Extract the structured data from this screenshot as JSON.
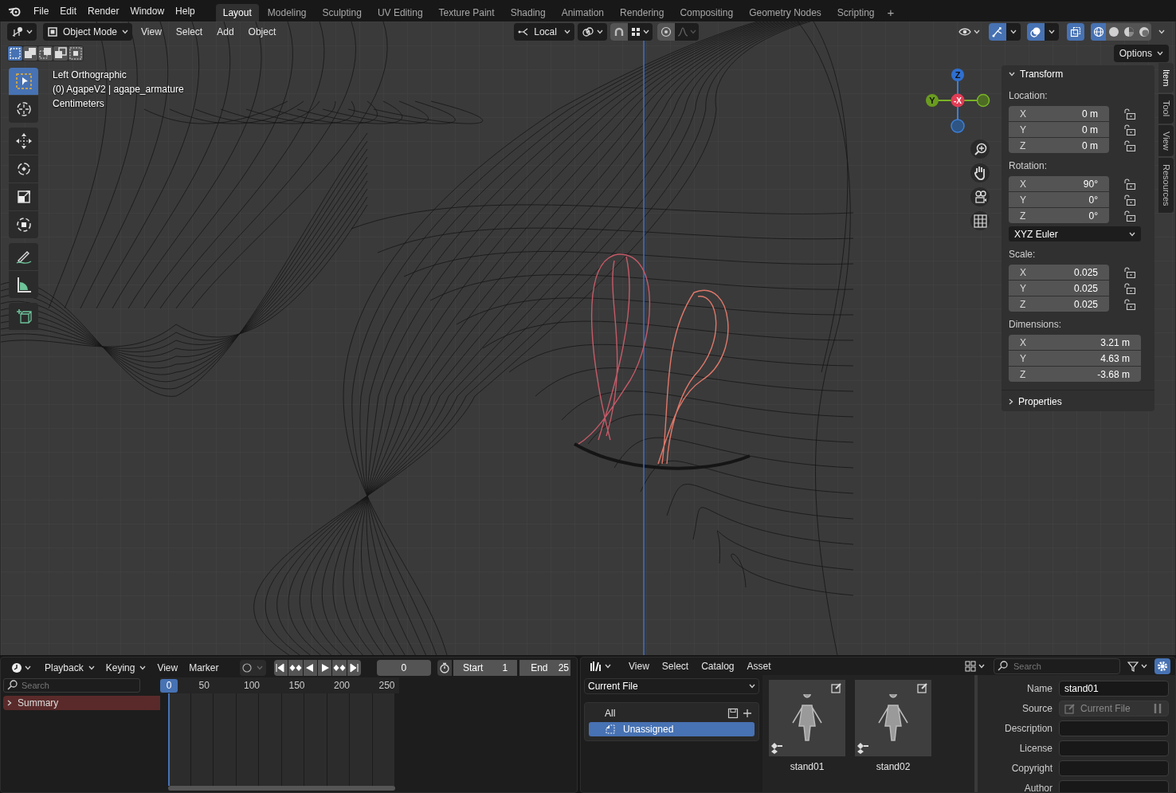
{
  "menu": [
    "File",
    "Edit",
    "Render",
    "Window",
    "Help"
  ],
  "workspaces": [
    {
      "label": "Layout",
      "selected": true
    },
    {
      "label": "Modeling",
      "selected": false
    },
    {
      "label": "Sculpting",
      "selected": false
    },
    {
      "label": "UV Editing",
      "selected": false
    },
    {
      "label": "Texture Paint",
      "selected": false
    },
    {
      "label": "Shading",
      "selected": false
    },
    {
      "label": "Animation",
      "selected": false
    },
    {
      "label": "Rendering",
      "selected": false
    },
    {
      "label": "Compositing",
      "selected": false
    },
    {
      "label": "Geometry Nodes",
      "selected": false
    },
    {
      "label": "Scripting",
      "selected": false
    }
  ],
  "add_workspace": "+",
  "viewport_header": {
    "mode": "Object Mode",
    "menus": [
      "View",
      "Select",
      "Add",
      "Object"
    ],
    "orientation": "Local"
  },
  "select_modes": [
    {
      "selected": true
    },
    {
      "selected": false
    },
    {
      "selected": false
    },
    {
      "selected": false
    },
    {
      "selected": false
    }
  ],
  "shading_modes": [
    {
      "kind": "wireframe",
      "selected": true
    },
    {
      "kind": "solid",
      "selected": false
    },
    {
      "kind": "material",
      "selected": false
    },
    {
      "kind": "rendered",
      "selected": false
    }
  ],
  "options_label": "Options",
  "overlay_text": [
    "Left Orthographic",
    "(0) AgapeV2 | agape_armature",
    "Centimeters"
  ],
  "tools": [
    {
      "kind": "select",
      "selected": true
    },
    {
      "kind": "cursor",
      "selected": false
    },
    {
      "kind": "move",
      "selected": false
    },
    {
      "kind": "rotate",
      "selected": false
    },
    {
      "kind": "scale",
      "selected": false
    },
    {
      "kind": "transform",
      "selected": false
    },
    {
      "kind": "annotate",
      "selected": false
    },
    {
      "kind": "measure",
      "selected": false
    },
    {
      "kind": "add-cube",
      "selected": false
    }
  ],
  "gizmo": {
    "up": "Z",
    "side": "Y",
    "front": "-X"
  },
  "sidebar": {
    "tabs": [
      {
        "label": "Item",
        "selected": true
      },
      {
        "label": "Tool",
        "selected": false
      },
      {
        "label": "View",
        "selected": false
      },
      {
        "label": "Resources",
        "selected": false
      }
    ],
    "transform": {
      "title": "Transform",
      "expanded": true,
      "groups": [
        {
          "label": "Location:",
          "kind": "lockable",
          "rows": [
            {
              "axis": "X",
              "value": "0 m"
            },
            {
              "axis": "Y",
              "value": "0 m"
            },
            {
              "axis": "Z",
              "value": "0 m"
            }
          ]
        },
        {
          "label": "Rotation:",
          "kind": "lockable",
          "rows": [
            {
              "axis": "X",
              "value": "90°"
            },
            {
              "axis": "Y",
              "value": "0°"
            },
            {
              "axis": "Z",
              "value": "0°"
            }
          ],
          "mode": "XYZ Euler"
        },
        {
          "label": "Scale:",
          "kind": "lockable",
          "rows": [
            {
              "axis": "X",
              "value": "0.025"
            },
            {
              "axis": "Y",
              "value": "0.025"
            },
            {
              "axis": "Z",
              "value": "0.025"
            }
          ]
        },
        {
          "label": "Dimensions:",
          "kind": "plain",
          "rows": [
            {
              "axis": "X",
              "value": "3.21 m"
            },
            {
              "axis": "Y",
              "value": "4.63 m"
            },
            {
              "axis": "Z",
              "value": "-3.68 m"
            }
          ]
        }
      ]
    },
    "properties": {
      "title": "Properties",
      "expanded": false
    }
  },
  "timeline": {
    "menus": [
      "Playback",
      "Keying"
    ],
    "plain_menus": [
      "View",
      "Marker"
    ],
    "current_frame": "0",
    "start_label": "Start",
    "start": "1",
    "end_label": "End",
    "end": "25",
    "search_placeholder": "Search",
    "ruler": [
      "0",
      "50",
      "100",
      "150",
      "200",
      "250"
    ],
    "channels": [
      {
        "label": "Summary",
        "expanded": false
      }
    ]
  },
  "asset_browser": {
    "menus": [
      "View",
      "Select",
      "Catalog",
      "Asset"
    ],
    "search_placeholder": "Search",
    "library": "Current File",
    "catalogs": [
      {
        "label": "All",
        "selected": false
      },
      {
        "label": "Unassigned",
        "selected": true
      }
    ],
    "assets": [
      {
        "name": "stand01"
      },
      {
        "name": "stand02"
      }
    ],
    "metadata": [
      {
        "label": "Name",
        "value": "stand01",
        "disabled": false
      },
      {
        "label": "Source",
        "value": "Current File",
        "disabled": true
      },
      {
        "label": "Description",
        "disabled": false
      },
      {
        "label": "License",
        "disabled": false
      },
      {
        "label": "Copyright",
        "disabled": false
      },
      {
        "label": "Author",
        "disabled": false
      }
    ]
  }
}
